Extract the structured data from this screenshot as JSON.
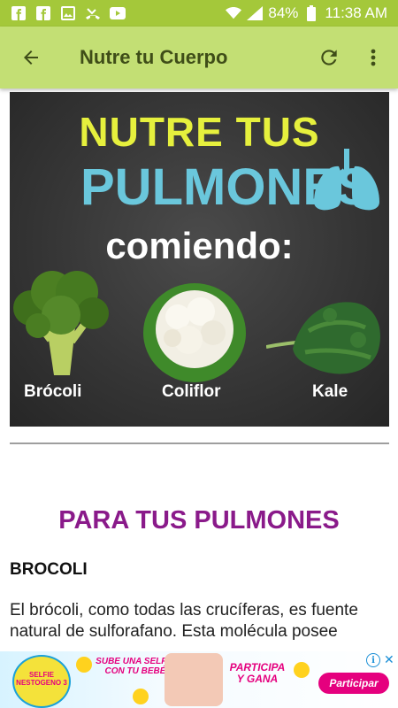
{
  "status_bar": {
    "battery": "84%",
    "time": "11:38 AM",
    "icons": [
      "facebook-icon",
      "facebook-icon",
      "image-icon",
      "missed-call-icon",
      "youtube-icon",
      "wifi-icon",
      "signal-icon",
      "battery-icon"
    ]
  },
  "app_bar": {
    "title": "Nutre tu Cuerpo",
    "icons": [
      "back-arrow-icon",
      "refresh-icon",
      "more-vert-icon"
    ]
  },
  "hero": {
    "line1": "NUTRE TUS",
    "line2": "PULMONES",
    "line3": "comiendo:",
    "foods": [
      {
        "label": "Brócoli"
      },
      {
        "label": "Coliflor"
      },
      {
        "label": "Kale"
      }
    ]
  },
  "article": {
    "section_title": "PARA TUS PULMONES",
    "subheading": "BROCOLI",
    "body": "El brócoli, como todas las crucíferas, es fuente natural de sulforafano. Esta molécula posee"
  },
  "ad": {
    "logo_text": "SELFIE NESTOGENO 3",
    "text1": "SUBE UNA SELFIE CON TU BEBÉ",
    "text2": "PARTICIPA Y GANA",
    "cta": "Participar",
    "info": "i",
    "close": "✕"
  },
  "colors": {
    "status_bar": "#a4c83a",
    "app_bar": "#c3df74",
    "title_text": "#3f4d18",
    "section_title": "#8a1a8a",
    "hero_yellow": "#e6f03d",
    "hero_blue": "#6ac7dc",
    "ad_pink": "#e5007e"
  }
}
